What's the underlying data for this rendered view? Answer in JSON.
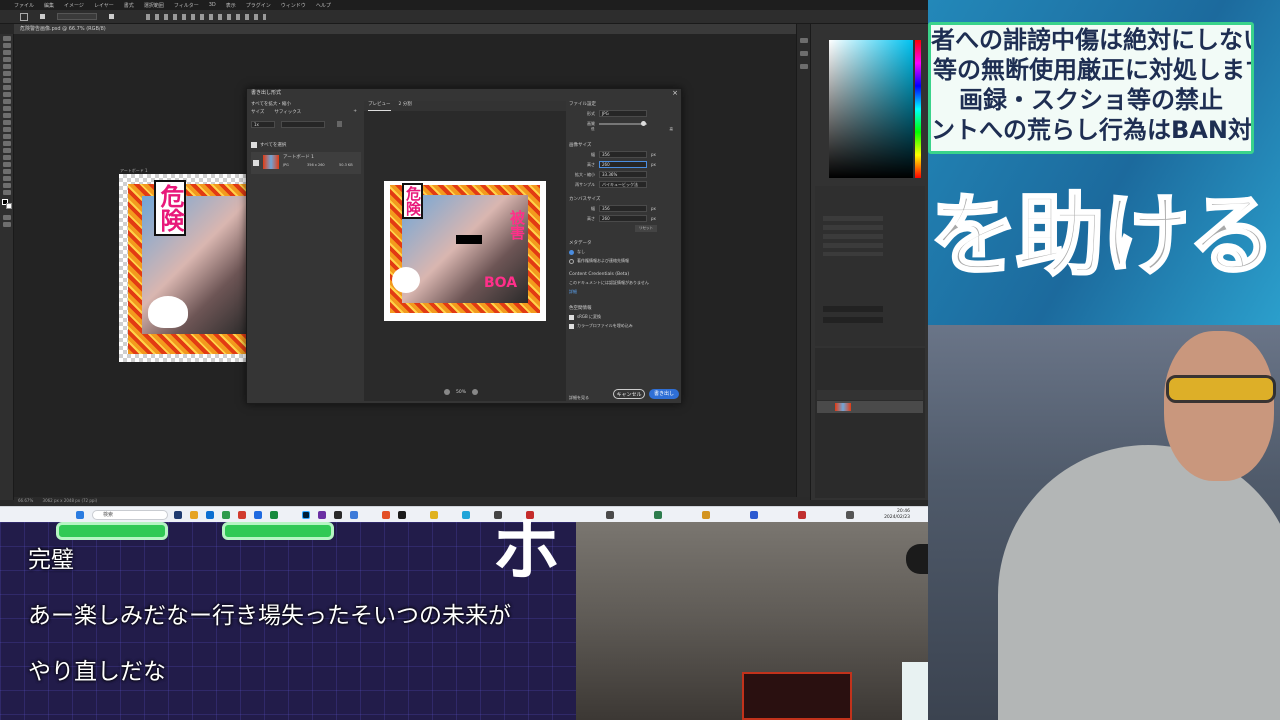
{
  "photoshop": {
    "menu": [
      "ファイル",
      "編集",
      "イメージ",
      "レイヤー",
      "書式",
      "選択範囲",
      "フィルター",
      "3D",
      "表示",
      "プラグイン",
      "ウィンドウ",
      "ヘルプ"
    ],
    "tab_label": "危険警告画像.psd @ 66.7% (RGB/8)",
    "status_left": "66.67%",
    "status_right": "3062 px x 2048 px (72 ppi)"
  },
  "dialog": {
    "title": "書き出し形式",
    "close": "×",
    "left_section_label": "すべてを拡大・縮小",
    "col_size": "サイズ",
    "col_suffix": "サフィックス",
    "size_value": "1x",
    "plus": "+",
    "select_all_label": "すべてを選択",
    "artboard_name": "アートボード 1",
    "artboard_format": "JPG",
    "artboard_dims": "356 x 260",
    "artboard_size": "50.3 KB",
    "preview_tab": "プレビュー",
    "compare_tab": "2 分割",
    "zoom": "50%",
    "file_settings": "ファイル設定",
    "format_label": "形式",
    "format_value": "JPG",
    "quality_label": "画質",
    "quality_low": "低",
    "quality_high": "高",
    "image_size": "画像サイズ",
    "width_label": "幅",
    "width_value": "356",
    "height_label": "高さ",
    "height_value": "260",
    "unit": "px",
    "scale_label": "拡大・縮小",
    "scale_value": "33.36%",
    "resample_label": "再サンプル",
    "resample_value": "バイキュービック法",
    "canvas_size": "カンバスサイズ",
    "cw_value": "356",
    "ch_value": "260",
    "reset": "リセット",
    "metadata": "メタデータ",
    "meta_none": "なし",
    "meta_copyright": "著作権情報および連絡先情報",
    "content_credentials": "Content Credentials (Beta)",
    "cc_note": "このドキュメントには認証情報がありません",
    "detail": "詳細",
    "color_space": "色空間情報",
    "cs_convert": "sRGB に変換",
    "cs_embed": "カラープロファイルを埋め込み",
    "learn": "詳細を見る",
    "cancel": "キャンセル",
    "export": "書き出し"
  },
  "artwork": {
    "danger": "危険",
    "damage": "被害",
    "letters": "BOA"
  },
  "taskbar": {
    "search_placeholder": "検索",
    "time": "20:46",
    "date": "2024/02/23"
  },
  "overlay": {
    "rules": [
      "者への誹謗中傷は絶対にしない事",
      "等の無断使用厳正に対処します",
      "画録・スクショ等の禁止",
      "ントへの荒らし行為はBAN対象"
    ],
    "headline": "を助ける"
  },
  "chat": {
    "lines": [
      "完璧",
      "あー楽しみだなー行き場失ったそいつの未来が",
      "やり直しだな"
    ],
    "big_glyph": "ホ"
  }
}
